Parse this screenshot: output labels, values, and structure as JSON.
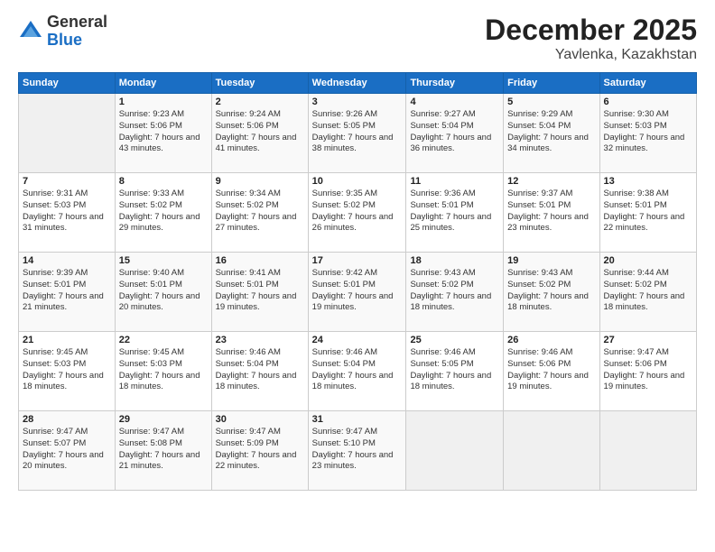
{
  "logo": {
    "general": "General",
    "blue": "Blue"
  },
  "header": {
    "month": "December 2025",
    "location": "Yavlenka, Kazakhstan"
  },
  "weekdays": [
    "Sunday",
    "Monday",
    "Tuesday",
    "Wednesday",
    "Thursday",
    "Friday",
    "Saturday"
  ],
  "weeks": [
    [
      {
        "day": "",
        "sunrise": "",
        "sunset": "",
        "daylight": ""
      },
      {
        "day": "1",
        "sunrise": "Sunrise: 9:23 AM",
        "sunset": "Sunset: 5:06 PM",
        "daylight": "Daylight: 7 hours and 43 minutes."
      },
      {
        "day": "2",
        "sunrise": "Sunrise: 9:24 AM",
        "sunset": "Sunset: 5:06 PM",
        "daylight": "Daylight: 7 hours and 41 minutes."
      },
      {
        "day": "3",
        "sunrise": "Sunrise: 9:26 AM",
        "sunset": "Sunset: 5:05 PM",
        "daylight": "Daylight: 7 hours and 38 minutes."
      },
      {
        "day": "4",
        "sunrise": "Sunrise: 9:27 AM",
        "sunset": "Sunset: 5:04 PM",
        "daylight": "Daylight: 7 hours and 36 minutes."
      },
      {
        "day": "5",
        "sunrise": "Sunrise: 9:29 AM",
        "sunset": "Sunset: 5:04 PM",
        "daylight": "Daylight: 7 hours and 34 minutes."
      },
      {
        "day": "6",
        "sunrise": "Sunrise: 9:30 AM",
        "sunset": "Sunset: 5:03 PM",
        "daylight": "Daylight: 7 hours and 32 minutes."
      }
    ],
    [
      {
        "day": "7",
        "sunrise": "Sunrise: 9:31 AM",
        "sunset": "Sunset: 5:03 PM",
        "daylight": "Daylight: 7 hours and 31 minutes."
      },
      {
        "day": "8",
        "sunrise": "Sunrise: 9:33 AM",
        "sunset": "Sunset: 5:02 PM",
        "daylight": "Daylight: 7 hours and 29 minutes."
      },
      {
        "day": "9",
        "sunrise": "Sunrise: 9:34 AM",
        "sunset": "Sunset: 5:02 PM",
        "daylight": "Daylight: 7 hours and 27 minutes."
      },
      {
        "day": "10",
        "sunrise": "Sunrise: 9:35 AM",
        "sunset": "Sunset: 5:02 PM",
        "daylight": "Daylight: 7 hours and 26 minutes."
      },
      {
        "day": "11",
        "sunrise": "Sunrise: 9:36 AM",
        "sunset": "Sunset: 5:01 PM",
        "daylight": "Daylight: 7 hours and 25 minutes."
      },
      {
        "day": "12",
        "sunrise": "Sunrise: 9:37 AM",
        "sunset": "Sunset: 5:01 PM",
        "daylight": "Daylight: 7 hours and 23 minutes."
      },
      {
        "day": "13",
        "sunrise": "Sunrise: 9:38 AM",
        "sunset": "Sunset: 5:01 PM",
        "daylight": "Daylight: 7 hours and 22 minutes."
      }
    ],
    [
      {
        "day": "14",
        "sunrise": "Sunrise: 9:39 AM",
        "sunset": "Sunset: 5:01 PM",
        "daylight": "Daylight: 7 hours and 21 minutes."
      },
      {
        "day": "15",
        "sunrise": "Sunrise: 9:40 AM",
        "sunset": "Sunset: 5:01 PM",
        "daylight": "Daylight: 7 hours and 20 minutes."
      },
      {
        "day": "16",
        "sunrise": "Sunrise: 9:41 AM",
        "sunset": "Sunset: 5:01 PM",
        "daylight": "Daylight: 7 hours and 19 minutes."
      },
      {
        "day": "17",
        "sunrise": "Sunrise: 9:42 AM",
        "sunset": "Sunset: 5:01 PM",
        "daylight": "Daylight: 7 hours and 19 minutes."
      },
      {
        "day": "18",
        "sunrise": "Sunrise: 9:43 AM",
        "sunset": "Sunset: 5:02 PM",
        "daylight": "Daylight: 7 hours and 18 minutes."
      },
      {
        "day": "19",
        "sunrise": "Sunrise: 9:43 AM",
        "sunset": "Sunset: 5:02 PM",
        "daylight": "Daylight: 7 hours and 18 minutes."
      },
      {
        "day": "20",
        "sunrise": "Sunrise: 9:44 AM",
        "sunset": "Sunset: 5:02 PM",
        "daylight": "Daylight: 7 hours and 18 minutes."
      }
    ],
    [
      {
        "day": "21",
        "sunrise": "Sunrise: 9:45 AM",
        "sunset": "Sunset: 5:03 PM",
        "daylight": "Daylight: 7 hours and 18 minutes."
      },
      {
        "day": "22",
        "sunrise": "Sunrise: 9:45 AM",
        "sunset": "Sunset: 5:03 PM",
        "daylight": "Daylight: 7 hours and 18 minutes."
      },
      {
        "day": "23",
        "sunrise": "Sunrise: 9:46 AM",
        "sunset": "Sunset: 5:04 PM",
        "daylight": "Daylight: 7 hours and 18 minutes."
      },
      {
        "day": "24",
        "sunrise": "Sunrise: 9:46 AM",
        "sunset": "Sunset: 5:04 PM",
        "daylight": "Daylight: 7 hours and 18 minutes."
      },
      {
        "day": "25",
        "sunrise": "Sunrise: 9:46 AM",
        "sunset": "Sunset: 5:05 PM",
        "daylight": "Daylight: 7 hours and 18 minutes."
      },
      {
        "day": "26",
        "sunrise": "Sunrise: 9:46 AM",
        "sunset": "Sunset: 5:06 PM",
        "daylight": "Daylight: 7 hours and 19 minutes."
      },
      {
        "day": "27",
        "sunrise": "Sunrise: 9:47 AM",
        "sunset": "Sunset: 5:06 PM",
        "daylight": "Daylight: 7 hours and 19 minutes."
      }
    ],
    [
      {
        "day": "28",
        "sunrise": "Sunrise: 9:47 AM",
        "sunset": "Sunset: 5:07 PM",
        "daylight": "Daylight: 7 hours and 20 minutes."
      },
      {
        "day": "29",
        "sunrise": "Sunrise: 9:47 AM",
        "sunset": "Sunset: 5:08 PM",
        "daylight": "Daylight: 7 hours and 21 minutes."
      },
      {
        "day": "30",
        "sunrise": "Sunrise: 9:47 AM",
        "sunset": "Sunset: 5:09 PM",
        "daylight": "Daylight: 7 hours and 22 minutes."
      },
      {
        "day": "31",
        "sunrise": "Sunrise: 9:47 AM",
        "sunset": "Sunset: 5:10 PM",
        "daylight": "Daylight: 7 hours and 23 minutes."
      },
      {
        "day": "",
        "sunrise": "",
        "sunset": "",
        "daylight": ""
      },
      {
        "day": "",
        "sunrise": "",
        "sunset": "",
        "daylight": ""
      },
      {
        "day": "",
        "sunrise": "",
        "sunset": "",
        "daylight": ""
      }
    ]
  ]
}
